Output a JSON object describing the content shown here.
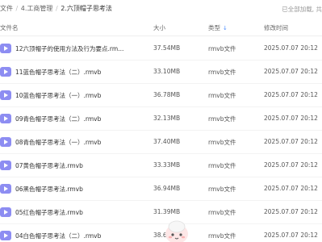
{
  "breadcrumb": {
    "items": [
      "文件",
      "4.工商管理",
      "2.六顶帽子思考法"
    ],
    "separator": "/"
  },
  "status": {
    "loaded_text": "已全部加载, 共"
  },
  "table": {
    "headers": {
      "name": "文件名",
      "size": "大小",
      "type": "类型",
      "time": "修改时间"
    },
    "sort_column": "type",
    "rows": [
      {
        "name": "12六顶帽子的使用方法及行为要点.rm...",
        "size": "37.54MB",
        "type": "rmvb文件",
        "time": "2025.07.07 20:12"
      },
      {
        "name": "11蓝色帽子思考法（二）.rmvb",
        "size": "33.10MB",
        "type": "rmvb文件",
        "time": "2025.07.07 20:12"
      },
      {
        "name": "10蓝色帽子思考法（一）.rmvb",
        "size": "36.78MB",
        "type": "rmvb文件",
        "time": "2025.07.07 20:12"
      },
      {
        "name": "09青色帽子思考法（二）.rmvb",
        "size": "32.13MB",
        "type": "rmvb文件",
        "time": "2025.07.07 20:12"
      },
      {
        "name": "08青色帽子思考法（一）.rmvb",
        "size": "37.40MB",
        "type": "rmvb文件",
        "time": "2025.07.07 20:12"
      },
      {
        "name": "07黄色帽子思考法.rmvb",
        "size": "33.33MB",
        "type": "rmvb文件",
        "time": "2025.07.07 20:12"
      },
      {
        "name": "06黑色帽子思考法.rmvb",
        "size": "36.94MB",
        "type": "rmvb文件",
        "time": "2025.07.07 20:12"
      },
      {
        "name": "05红色帽子思考法.rmvb",
        "size": "31.39MB",
        "type": "rmvb文件",
        "time": "2025.07.07 20:12"
      },
      {
        "name": "04白色帽子思考法（二）.rmvb",
        "size": "38.6",
        "type": "rmvb文件",
        "time": "2025.07.07 20:12"
      }
    ]
  },
  "colors": {
    "file_icon": "#8d8df2",
    "sort_arrow": "#4a8cff"
  },
  "icons": {
    "file": "video-file-icon",
    "sort": "sort-arrow-icon",
    "mascot": "mascot-icon"
  }
}
